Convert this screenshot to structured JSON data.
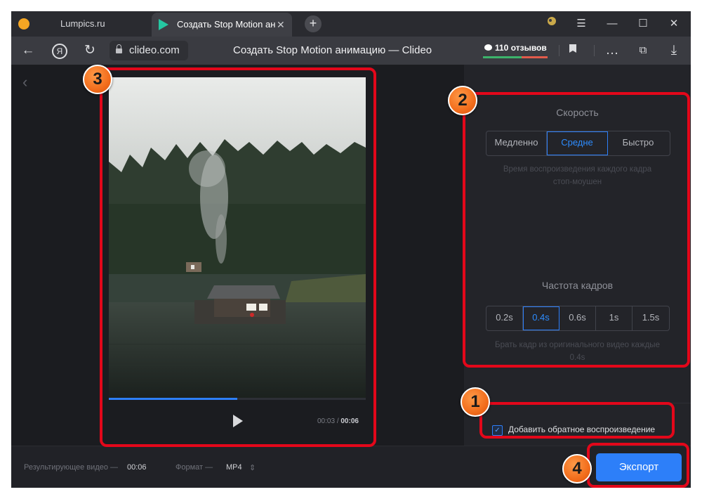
{
  "browser": {
    "tabs": [
      {
        "title": "Lumpics.ru"
      },
      {
        "title": "Создать Stop Motion анимацию — Clideo"
      }
    ],
    "url": "clideo.com",
    "page_title": "Создать Stop Motion анимацию — Clideo",
    "reviews": "110 отзывов"
  },
  "player": {
    "current_time": "00:03",
    "separator": "/",
    "duration": "00:06",
    "progress": 0.5
  },
  "settings": {
    "speed": {
      "title": "Скорость",
      "options": [
        "Медленно",
        "Средне",
        "Быстро"
      ],
      "selected": "Средне",
      "hint_line1": "Время воспроизведения каждого кадра",
      "hint_line2": "стоп-моушен"
    },
    "framerate": {
      "title": "Частота кадров",
      "options": [
        "0.2s",
        "0.4s",
        "0.6s",
        "1s",
        "1.5s"
      ],
      "selected": "0.4s",
      "hint_line1": "Брать кадр из оригинального видео каждые",
      "hint_line2": "0.4s"
    },
    "reverse": {
      "label": "Добавить обратное воспроизведение",
      "checked": true
    }
  },
  "footer": {
    "result_label": "Результирующее видео —",
    "result_value": "00:06",
    "format_label": "Формат —",
    "format_value": "MP4",
    "export_label": "Экспорт"
  },
  "annotations": {
    "b1": "1",
    "b2": "2",
    "b3": "3",
    "b4": "4"
  },
  "colors": {
    "accent": "#2d7ff9",
    "annotation": "#e3071a",
    "badge": "#f26d1c"
  }
}
